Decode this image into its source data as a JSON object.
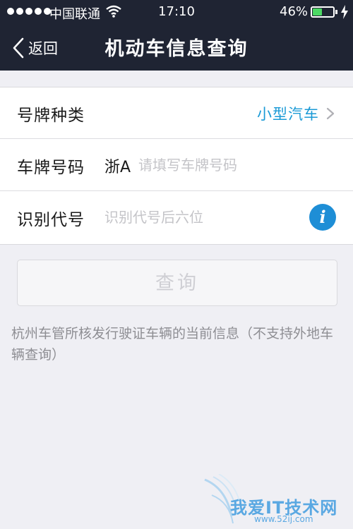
{
  "status_bar": {
    "carrier": "中国联通",
    "time": "17:10",
    "battery_percent": "46%",
    "battery_level": 0.46,
    "signal_dots": 5
  },
  "nav": {
    "back_label": "返回",
    "title": "机动车信息查询"
  },
  "form": {
    "plate_type": {
      "label": "号牌种类",
      "value": "小型汽车"
    },
    "plate_number": {
      "label": "车牌号码",
      "prefix": "浙A",
      "placeholder": "请填写车牌号码",
      "value": ""
    },
    "vin": {
      "label": "识别代号",
      "placeholder": "识别代号后六位",
      "value": ""
    }
  },
  "query_button": {
    "label": "查询"
  },
  "note": "杭州车管所核发行驶证车辆的当前信息（不支持外地车辆查询）",
  "watermark": {
    "text": "我爱IT技术网",
    "sub": "www.52ij.com"
  },
  "colors": {
    "header_bg": "#1f2433",
    "accent": "#1a9ad6",
    "info_icon": "#1e8ed6",
    "battery": "#4cd964",
    "page_bg": "#efeff4"
  }
}
